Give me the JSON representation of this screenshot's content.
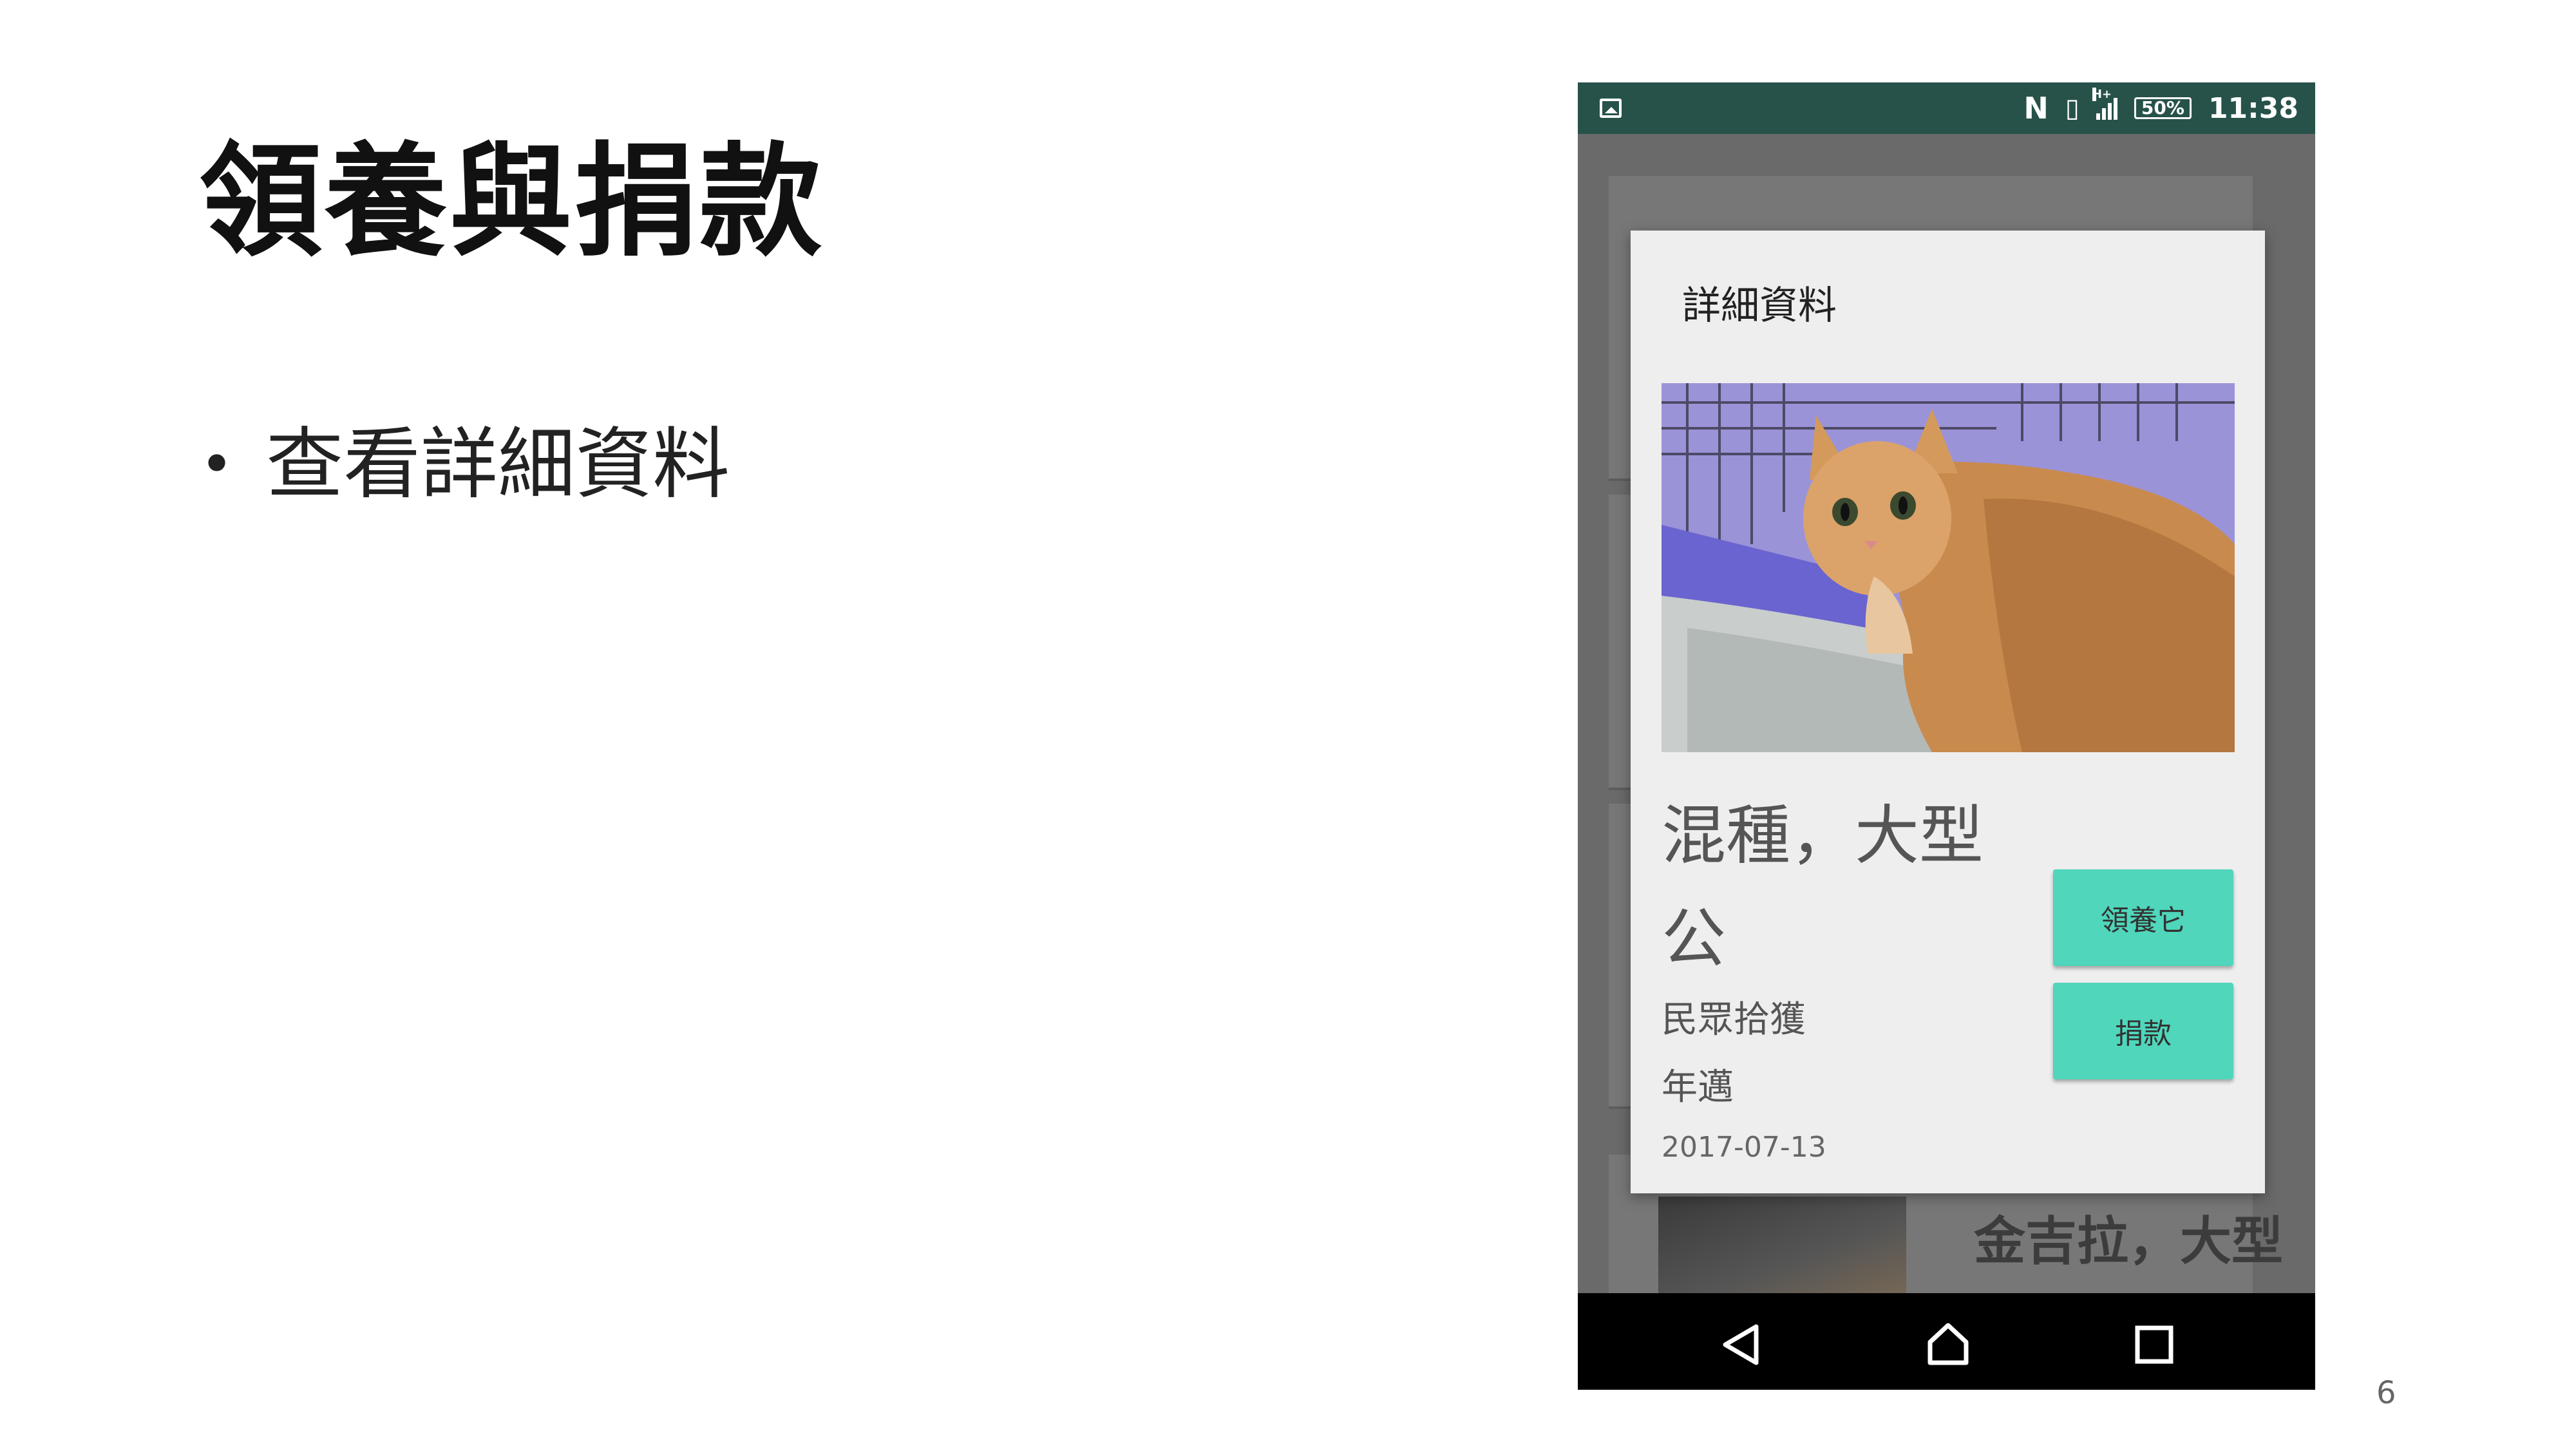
{
  "slide": {
    "title": "領養與捐款",
    "bullet": "查看詳細資料",
    "page_number": "6"
  },
  "phone": {
    "status_bar": {
      "network": "H+",
      "battery": "50%",
      "time": "11:38",
      "icons": [
        "gallery-icon",
        "nfc-icon",
        "vibrate-icon",
        "signal-icon",
        "battery-icon"
      ]
    },
    "background_list": {
      "visible_card_title": "金吉拉，大型"
    },
    "dialog": {
      "title": "詳細資料",
      "name_line1": "混種，大型",
      "name_line2": "公",
      "source": "民眾拾獲",
      "age": "年邁",
      "date": "2017-07-13",
      "adopt_button": "領養它",
      "donate_button": "捐款"
    },
    "nav_bar": {
      "icons": [
        "back-icon",
        "home-icon",
        "recent-apps-icon"
      ]
    },
    "colors": {
      "status_bar": "#27524a",
      "accent_button": "#4fd6bb",
      "dialog_bg": "#eeeeee",
      "scrim": "#6a6a6a"
    }
  }
}
